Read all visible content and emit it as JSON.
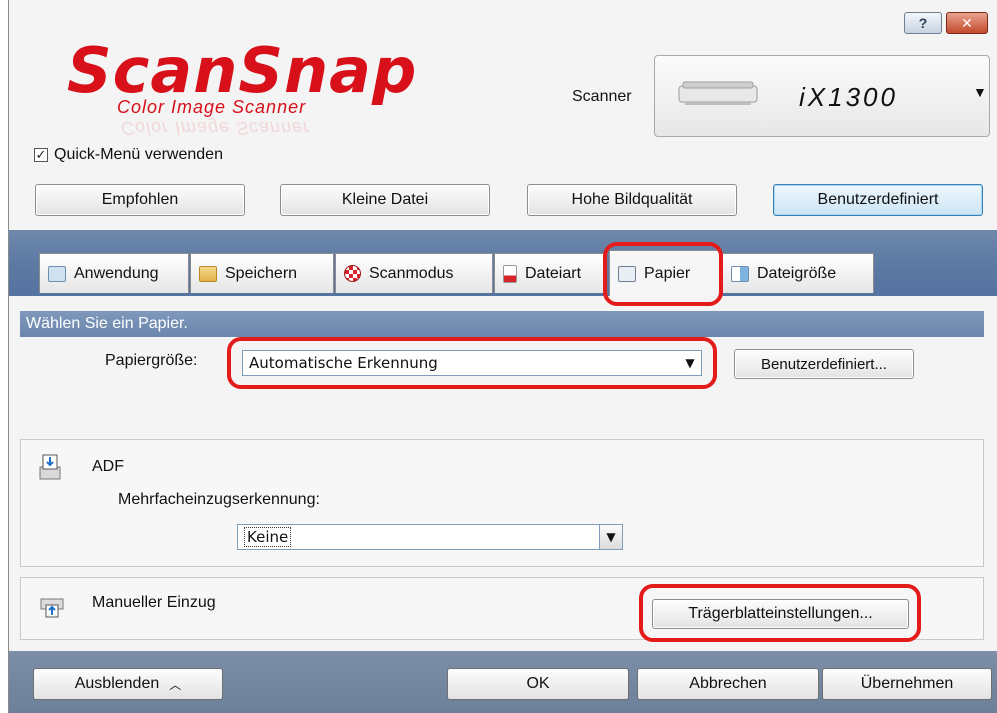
{
  "titlebar": {
    "help_icon": "question-icon",
    "close_icon": "close-icon",
    "help_glyph": "?",
    "close_glyph": "✕"
  },
  "logo": {
    "brand": "ScanSnap",
    "tagline": "Color Image Scanner"
  },
  "scanner": {
    "label": "Scanner",
    "model": "iX1300",
    "dropdown_icon": "triangle-down"
  },
  "quick_menu": {
    "checked": true,
    "label": "Quick-Menü verwenden"
  },
  "presets": [
    {
      "label": "Empfohlen",
      "active": false
    },
    {
      "label": "Kleine Datei",
      "active": false
    },
    {
      "label": "Hohe Bildqualität",
      "active": false
    },
    {
      "label": "Benutzerdefiniert",
      "active": true
    }
  ],
  "tabs": [
    {
      "label": "Anwendung",
      "icon": "application-icon"
    },
    {
      "label": "Speichern",
      "icon": "folder-icon"
    },
    {
      "label": "Scanmodus",
      "icon": "scanmode-icon"
    },
    {
      "label": "Dateiart",
      "icon": "file-type-icon"
    },
    {
      "label": "Papier",
      "icon": "paper-icon",
      "selected": true
    },
    {
      "label": "Dateigröße",
      "icon": "file-size-icon"
    }
  ],
  "paper": {
    "section_title": "Wählen Sie ein Papier.",
    "size_label": "Papiergröße:",
    "size_value": "Automatische Erkennung",
    "custom_button": "Benutzerdefiniert..."
  },
  "adf": {
    "title": "ADF",
    "multifeed_label": "Mehrfacheinzugserkennung:",
    "multifeed_value": "Keine"
  },
  "manual_feed": {
    "title": "Manueller Einzug",
    "carrier_button": "Trägerblatteinstellungen..."
  },
  "footer": {
    "hide_label": "Ausblenden",
    "hide_icon": "chevron-up-icon",
    "ok_label": "OK",
    "cancel_label": "Abbrechen",
    "apply_label": "Übernehmen"
  },
  "colors": {
    "accent_red": "#e41b1b",
    "band_blue": "#5d7aa3",
    "logo_red": "#d8101a"
  }
}
